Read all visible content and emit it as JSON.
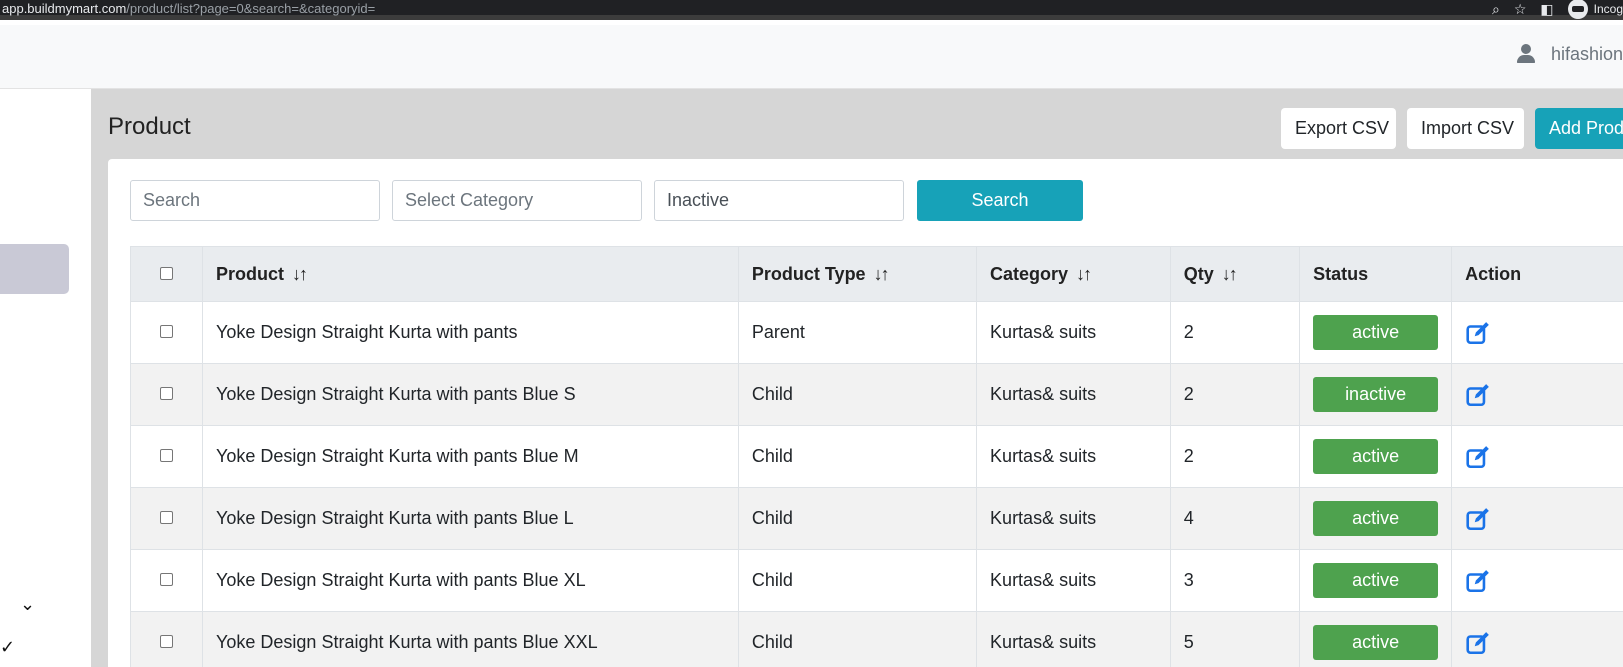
{
  "browser": {
    "url_domain": "app.buildmymart.com",
    "url_path": "/product/list?page=0&search=&categoryid=",
    "profile_label": "Incog"
  },
  "header": {
    "username": "hifashion"
  },
  "page": {
    "title": "Product",
    "export_label": "Export CSV",
    "import_label": "Import CSV",
    "add_label": "Add Product"
  },
  "filters": {
    "search_placeholder": "Search",
    "category_placeholder": "Select Category",
    "status_value": "Inactive",
    "search_button": "Search"
  },
  "table": {
    "columns": [
      "Product",
      "Product Type",
      "Category",
      "Qty",
      "Status",
      "Action"
    ],
    "sort_glyph": "↓↑",
    "rows": [
      {
        "product": "Yoke Design Straight Kurta with pants",
        "type": "Parent",
        "category": "Kurtas& suits",
        "qty": "2",
        "status": "active"
      },
      {
        "product": "Yoke Design Straight Kurta with pants Blue S",
        "type": "Child",
        "category": "Kurtas& suits",
        "qty": "2",
        "status": "inactive"
      },
      {
        "product": "Yoke Design Straight Kurta with pants Blue M",
        "type": "Child",
        "category": "Kurtas& suits",
        "qty": "2",
        "status": "active"
      },
      {
        "product": "Yoke Design Straight Kurta with pants Blue L",
        "type": "Child",
        "category": "Kurtas& suits",
        "qty": "4",
        "status": "active"
      },
      {
        "product": "Yoke Design Straight Kurta with pants Blue XL",
        "type": "Child",
        "category": "Kurtas& suits",
        "qty": "3",
        "status": "active"
      },
      {
        "product": "Yoke Design Straight Kurta with pants Blue XXL",
        "type": "Child",
        "category": "Kurtas& suits",
        "qty": "5",
        "status": "active"
      }
    ]
  },
  "colors": {
    "accent": "#17a2b8",
    "status_green": "#4ea24e",
    "edit_blue": "#1a73e8"
  }
}
